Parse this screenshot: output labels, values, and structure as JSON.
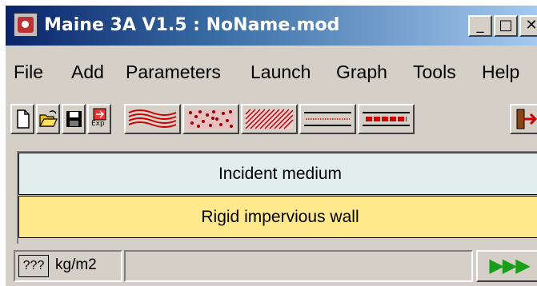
{
  "window": {
    "title": "Maine 3A V1.5 : NoName.mod"
  },
  "title_buttons": {
    "minimize": "_",
    "maximize": "□",
    "close": "✕"
  },
  "menu": [
    "File",
    "Add",
    "Parameters",
    "Launch",
    "Graph",
    "Tools",
    "Help"
  ],
  "toolbar": {
    "file_icons": [
      "new-icon",
      "open-icon",
      "save-icon",
      "export-icon"
    ],
    "export_label": "Exp",
    "layer_icons": [
      "wavy-layer-icon",
      "granular-layer-icon",
      "hatched-layer-icon",
      "thin-film-layer-icon",
      "red-band-layer-icon"
    ],
    "exit_icon": "exit-door-icon"
  },
  "layers": [
    {
      "label": "Incident medium",
      "color": "#e2eeee"
    },
    {
      "label": "Rigid impervious wall",
      "color": "#ffe98c"
    }
  ],
  "status": {
    "unit_value": "???",
    "unit_label": "kg/m2",
    "run_label": "▶▶▶"
  },
  "colors": {
    "accent_green": "#1a9e1a",
    "window_bg": "#d4d0c8",
    "title_start": "#0a246a"
  }
}
